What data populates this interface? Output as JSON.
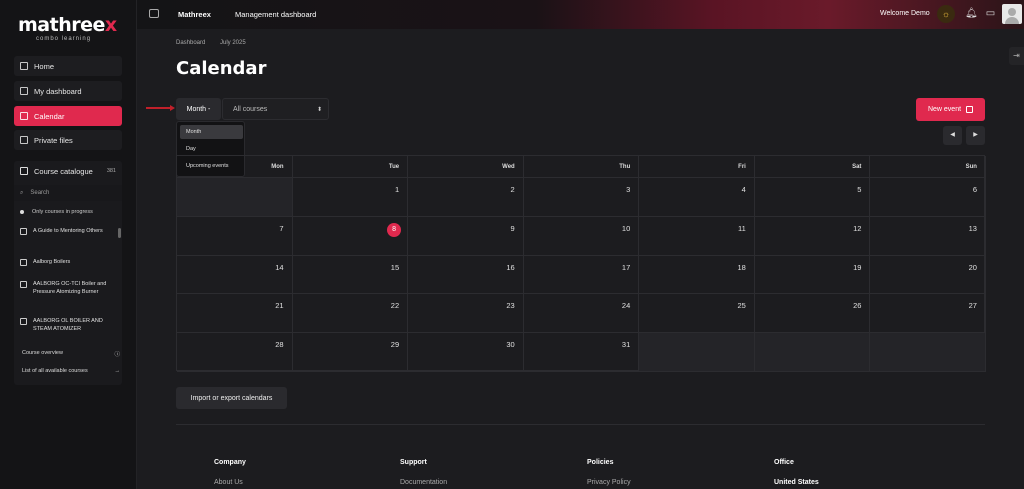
{
  "brand": {
    "name_main": "mathree",
    "name_x": "x",
    "tagline": "combo learning"
  },
  "sidebar": {
    "nav": [
      {
        "label": "Home",
        "name": "nav-home"
      },
      {
        "label": "My dashboard",
        "name": "nav-dashboard"
      },
      {
        "label": "Calendar",
        "name": "nav-calendar",
        "active": true
      },
      {
        "label": "Private files",
        "name": "nav-private-files"
      }
    ],
    "catalog": {
      "title": "Course catalogue",
      "count": "381",
      "search_placeholder": "Search",
      "filter": "Only courses in progress",
      "courses": [
        "A Guide to Mentoring Others",
        "Aalborg Boilers",
        "AALBORG OC-TCI Boiler and Pressure Atomizing Burner",
        "AALBORG OL BOILER AND STEAM ATOMIZER"
      ]
    },
    "course_overview": "Course overview",
    "all_courses": "List of all available courses"
  },
  "topbar": {
    "site": "Mathreex",
    "management": "Management dashboard",
    "welcome": "Welcome Demo"
  },
  "breadcrumb": {
    "root": "Dashboard",
    "current": "July 2025"
  },
  "page_title": "Calendar",
  "controls": {
    "view_button": "Month -",
    "course_select": "All courses",
    "view_options": [
      "Month",
      "Day",
      "Upcoming events"
    ],
    "new_event": "New event"
  },
  "calendar": {
    "weekdays": [
      "Mon",
      "Tue",
      "Wed",
      "Thu",
      "Fri",
      "Sat",
      "Sun"
    ],
    "weeks": [
      [
        "",
        "1",
        "2",
        "3",
        "4",
        "5",
        "6"
      ],
      [
        "7",
        "8",
        "9",
        "10",
        "11",
        "12",
        "13"
      ],
      [
        "14",
        "15",
        "16",
        "17",
        "18",
        "19",
        "20"
      ],
      [
        "21",
        "22",
        "23",
        "24",
        "25",
        "26",
        "27"
      ],
      [
        "28",
        "29",
        "30",
        "31",
        "",
        "",
        ""
      ]
    ],
    "today": "8"
  },
  "import_export": "Import or export calendars",
  "footer": {
    "columns": [
      {
        "title": "Company",
        "first": "About Us"
      },
      {
        "title": "Support",
        "first": "Documentation"
      },
      {
        "title": "Policies",
        "first": "Privacy Policy"
      },
      {
        "title": "Office",
        "first": "United States"
      }
    ]
  },
  "colors": {
    "accent": "#e0294e",
    "background": "#1c1c1f",
    "sidebar": "#141416"
  },
  "icons": [
    "sidebar-toggle-icon",
    "sun-icon",
    "bell-icon",
    "chat-icon",
    "search-icon",
    "calendar-plus-icon",
    "chevron-left-icon",
    "chevron-right-icon",
    "info-icon",
    "arrow-right-icon",
    "book-icon"
  ]
}
